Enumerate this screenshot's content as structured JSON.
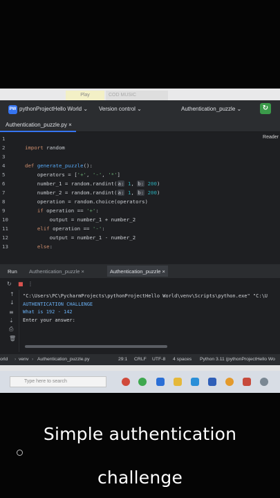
{
  "browser": {
    "tab_play": "Play",
    "tab_music": "COD MUSIC"
  },
  "titlebar": {
    "badge": "PW",
    "project": "pythonProjectHello World ⌄",
    "vcs": "Version control ⌄",
    "run_config": "Authentication_puzzle ⌄",
    "run_icon": "run-icon"
  },
  "editor_tab": {
    "label": "Authentication_puzzle.py  ×"
  },
  "editor": {
    "reader_mode": "Reader",
    "line_numbers": [
      "1",
      "2",
      "3",
      "4",
      "5",
      "6",
      "7",
      "8",
      "9",
      "10",
      "11",
      "12",
      "13"
    ]
  },
  "run_panel": {
    "title": "Run",
    "tabs": [
      "Authentication_puzzle  ×",
      "Authentication_puzzle  ×"
    ]
  },
  "console": {
    "path": "\"C:\\Users\\PC\\PycharmProjects\\pythonProjectHello World\\venv\\Scripts\\python.exe\" \"C:\\U",
    "header": "AUTHENTICATION CHALLENGE",
    "question": "What is 192 - 142",
    "prompt": "Enter your answer:"
  },
  "statusbar": {
    "crumb1": "orld",
    "crumb2": "venv",
    "crumb3": "Authentication_puzzle.py",
    "position": "29:1",
    "line_ending": "CRLF",
    "encoding": "UTF-8",
    "indent": "4 spaces",
    "interpreter": "Python 3.11 (pythonProjectHello Wo"
  },
  "windows": {
    "search_placeholder": "Type here to search"
  },
  "caption": {
    "line1": "Simple authentication",
    "line2": "challenge"
  },
  "colors": {
    "editor_bg": "#1e1f22",
    "keyword": "#cf8e6d",
    "function": "#56a8f5",
    "string": "#6aab73",
    "accent": "#3574f0",
    "run_green": "#3b9a4a"
  }
}
